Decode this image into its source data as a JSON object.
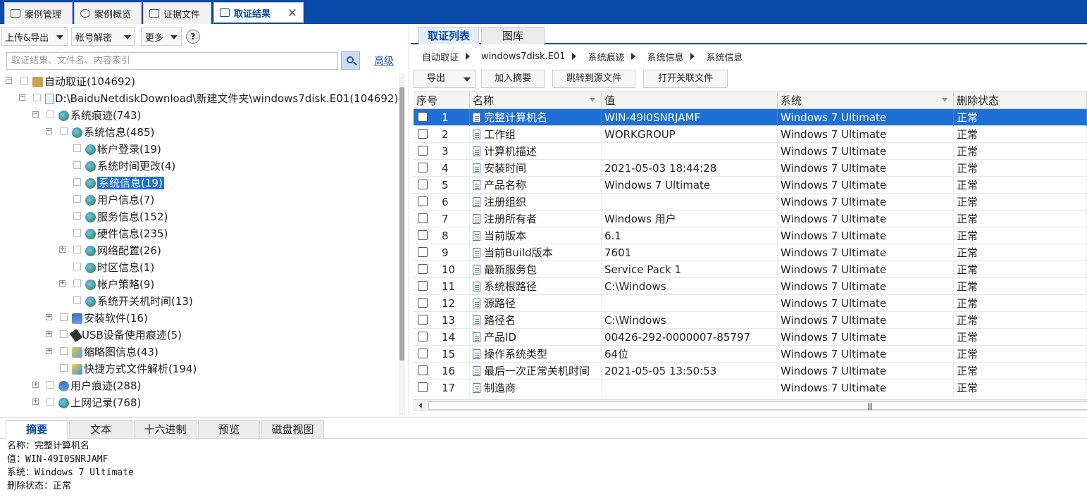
{
  "top_tabs": [
    {
      "label": "案例管理",
      "icon": "edit-icon"
    },
    {
      "label": "案例概览",
      "icon": "pie-chart-icon"
    },
    {
      "label": "证据文件",
      "icon": "files-icon"
    },
    {
      "label": "取证结果",
      "icon": "edit-icon",
      "active": true
    }
  ],
  "close_symbol": "✕",
  "left": {
    "toolbar": {
      "upload_export": "上传&导出",
      "account_decrypt": "帐号解密",
      "more": "更多",
      "help": "?"
    },
    "search": {
      "placeholder": "取证结果、文件名、内容索引",
      "advanced": "高级"
    },
    "tree": [
      {
        "label": "自动取证(104692)"
      },
      {
        "label": "D:\\BaiduNetdiskDownload\\新建文件夹\\windows7disk.E01(104692)"
      },
      {
        "label": "系统痕迹(743)"
      },
      {
        "label": "系统信息(485)"
      },
      {
        "label": "帐户登录(19)"
      },
      {
        "label": "系统时间更改(4)"
      },
      {
        "label": "系统信息(19)",
        "selected": true
      },
      {
        "label": "用户信息(7)"
      },
      {
        "label": "服务信息(152)"
      },
      {
        "label": "硬件信息(235)"
      },
      {
        "label": "网络配置(26)"
      },
      {
        "label": "时区信息(1)"
      },
      {
        "label": "帐户策略(9)"
      },
      {
        "label": "系统开关机时间(13)"
      },
      {
        "label": "安装软件(16)"
      },
      {
        "label": "USB设备使用痕迹(5)"
      },
      {
        "label": "缩略图信息(43)"
      },
      {
        "label": "快捷方式文件解析(194)"
      },
      {
        "label": "用户痕迹(288)"
      },
      {
        "label": "上网记录(768)"
      }
    ]
  },
  "right": {
    "tabs": [
      "取证列表",
      "图库"
    ],
    "breadcrumb": [
      "自动取证",
      "windows7disk.E01",
      "系统痕迹",
      "系统信息",
      "系统信息"
    ],
    "toolbar": {
      "export": "导出",
      "add_summary": "加入摘要",
      "jump_source": "跳转到源文件",
      "open_related": "打开关联文件"
    },
    "columns": [
      "序号",
      "名称",
      "值",
      "系统",
      "删除状态"
    ],
    "rows": [
      {
        "no": "1",
        "name": "完整计算机名",
        "value": "WIN-49I0SNRJAMF",
        "system": "Windows 7 Ultimate",
        "status": "正常",
        "selected": true
      },
      {
        "no": "2",
        "name": "工作组",
        "value": "WORKGROUP",
        "system": "Windows 7 Ultimate",
        "status": "正常"
      },
      {
        "no": "3",
        "name": "计算机描述",
        "value": "",
        "system": "Windows 7 Ultimate",
        "status": "正常"
      },
      {
        "no": "4",
        "name": "安装时间",
        "value": "2021-05-03 18:44:28",
        "system": "Windows 7 Ultimate",
        "status": "正常"
      },
      {
        "no": "5",
        "name": "产品名称",
        "value": "Windows 7 Ultimate",
        "system": "Windows 7 Ultimate",
        "status": "正常"
      },
      {
        "no": "6",
        "name": "注册组织",
        "value": "",
        "system": "Windows 7 Ultimate",
        "status": "正常"
      },
      {
        "no": "7",
        "name": "注册所有者",
        "value": "Windows 用户",
        "system": "Windows 7 Ultimate",
        "status": "正常"
      },
      {
        "no": "8",
        "name": "当前版本",
        "value": "6.1",
        "system": "Windows 7 Ultimate",
        "status": "正常"
      },
      {
        "no": "9",
        "name": "当前Build版本",
        "value": "7601",
        "system": "Windows 7 Ultimate",
        "status": "正常"
      },
      {
        "no": "10",
        "name": "最新服务包",
        "value": "Service Pack 1",
        "system": "Windows 7 Ultimate",
        "status": "正常"
      },
      {
        "no": "11",
        "name": "系统根路径",
        "value": "C:\\Windows",
        "system": "Windows 7 Ultimate",
        "status": "正常"
      },
      {
        "no": "12",
        "name": "源路径",
        "value": "",
        "system": "Windows 7 Ultimate",
        "status": "正常"
      },
      {
        "no": "13",
        "name": "路径名",
        "value": "C:\\Windows",
        "system": "Windows 7 Ultimate",
        "status": "正常"
      },
      {
        "no": "14",
        "name": "产品ID",
        "value": "00426-292-0000007-85797",
        "system": "Windows 7 Ultimate",
        "status": "正常"
      },
      {
        "no": "15",
        "name": "操作系统类型",
        "value": "64位",
        "system": "Windows 7 Ultimate",
        "status": "正常"
      },
      {
        "no": "16",
        "name": "最后一次正常关机时间",
        "value": "2021-05-05 13:50:53",
        "system": "Windows 7 Ultimate",
        "status": "正常"
      },
      {
        "no": "17",
        "name": "制造商",
        "value": "",
        "system": "Windows 7 Ultimate",
        "status": "正常"
      }
    ]
  },
  "bottom": {
    "tabs": [
      "摘要",
      "文本",
      "十六进制",
      "预览",
      "磁盘视图"
    ],
    "summary_lines": [
      "名称：完整计算机名",
      "值：WIN-49I0SNRJAMF",
      "系统：Windows 7 Ultimate",
      "删除状态：正常"
    ]
  },
  "colors": {
    "brand_blue": "#0a4aa8",
    "selection_blue": "#1e6fd6"
  }
}
